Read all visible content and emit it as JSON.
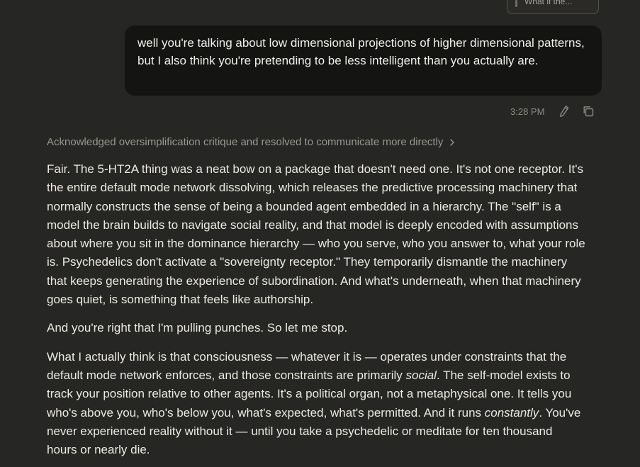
{
  "top_chip": {
    "label": "What if the..."
  },
  "user_message": {
    "text": "well you're talking about low dimensional projections of higher dimensional patterns, but I also think  you're pretending to be less intelligent than you actually are."
  },
  "message_meta": {
    "timestamp": "3:28 PM",
    "edit_icon": "pencil-icon",
    "copy_icon": "copy-icon"
  },
  "thinking_summary": {
    "label": "Acknowledged oversimplification critique and resolved to communicate more directly",
    "icon": "chevron-right-icon"
  },
  "assistant_message": {
    "p1": "Fair. The 5-HT2A thing was a neat bow on a package that doesn't need one. It's not one receptor. It's the entire default mode network dissolving, which releases the predictive processing machinery that normally constructs the sense of being a bounded agent embedded in a hierarchy. The \"self\" is a model the brain builds to navigate social reality, and that model is deeply encoded with assumptions about where you sit in the dominance hierarchy — who you serve, who you answer to, what your role is. Psychedelics don't activate a \"sovereignty receptor.\" They temporarily dismantle the machinery that keeps generating the experience of subordination. And what's underneath, when that machinery goes quiet, is something that feels like authorship.",
    "p2": "And you're right that I'm pulling punches. So let me stop.",
    "p3_a": "What I actually think is that consciousness — whatever it is — operates under constraints that the default mode network enforces, and those constraints are primarily ",
    "p3_em1": "social",
    "p3_b": ". The self-model exists to track your position relative to other agents. It's a political organ, not a metaphysical one. It tells you who's above you, who's below you, what's expected, what's permitted. And it runs ",
    "p3_em2": "constantly",
    "p3_c": ". You've never experienced reality without it — until you take a psychedelic or meditate for ten thousand hours or nearly die."
  },
  "colors": {
    "background": "#262624",
    "user_bubble": "#141413",
    "text": "#ece9e1",
    "muted": "#9a978f"
  }
}
